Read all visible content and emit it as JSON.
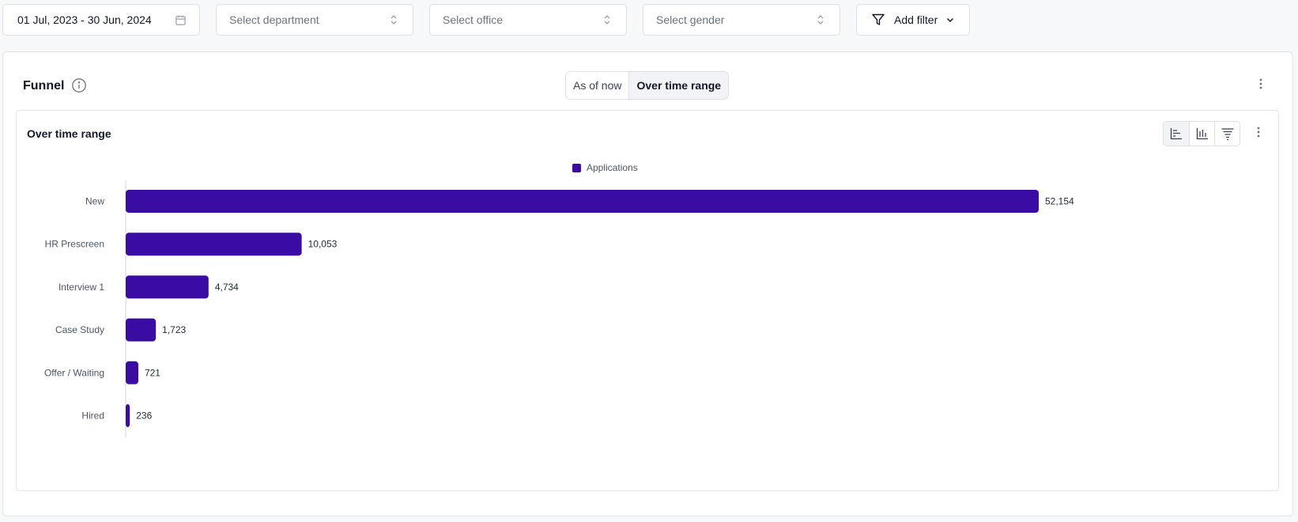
{
  "filters": {
    "date_range": "01 Jul, 2023 - 30 Jun, 2024",
    "department_placeholder": "Select department",
    "office_placeholder": "Select office",
    "gender_placeholder": "Select gender",
    "add_filter_label": "Add filter"
  },
  "card": {
    "title": "Funnel",
    "toggle": {
      "as_of_now": "As of now",
      "over_time_range": "Over time range",
      "selected": "over_time_range"
    }
  },
  "panel": {
    "title": "Over time range",
    "view_icons": [
      "horizontal-bar-chart-icon",
      "vertical-bar-chart-icon",
      "funnel-list-icon"
    ]
  },
  "colors": {
    "bar": "#3a0ca3",
    "axis": "#d1d5db"
  },
  "chart_data": {
    "type": "bar",
    "orientation": "horizontal",
    "categories": [
      "New",
      "HR Prescreen",
      "Interview 1",
      "Case Study",
      "Offer / Waiting",
      "Hired"
    ],
    "series": [
      {
        "name": "Applications",
        "values": [
          52154,
          10053,
          4734,
          1723,
          721,
          236
        ],
        "labels": [
          "52,154",
          "10,053",
          "4,734",
          "1,723",
          "721",
          "236"
        ]
      }
    ],
    "legend": "top-center",
    "grid": false
  }
}
